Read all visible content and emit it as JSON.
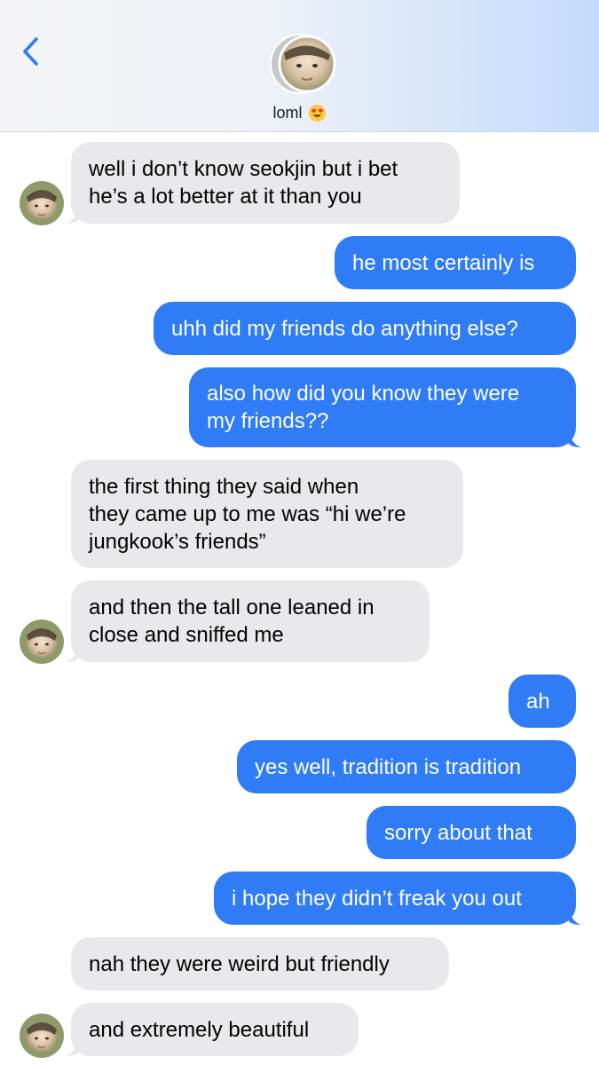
{
  "header": {
    "contact_name": "loml",
    "contact_emoji": "heart-eyes-emoji",
    "back_icon": "chevron-left-icon",
    "accent_color": "#2f7cf6"
  },
  "messages": [
    {
      "from": "them",
      "lines": [
        "well i don’t know seokjin but i bet",
        "he’s a lot better at it than you"
      ]
    },
    {
      "from": "me",
      "lines": [
        "he most certainly is"
      ]
    },
    {
      "from": "me",
      "lines": [
        "uhh did my friends do anything else?"
      ]
    },
    {
      "from": "me",
      "lines": [
        "also how did you know they were",
        "my friends??"
      ]
    },
    {
      "from": "them",
      "lines": [
        "the first thing they said when",
        "they came up to me was “hi we’re",
        "jungkook’s friends”"
      ]
    },
    {
      "from": "them",
      "lines": [
        "and then the tall one leaned in",
        "close and sniffed me"
      ]
    },
    {
      "from": "me",
      "lines": [
        "ah"
      ]
    },
    {
      "from": "me",
      "lines": [
        "yes well, tradition is tradition"
      ]
    },
    {
      "from": "me",
      "lines": [
        "sorry about that"
      ]
    },
    {
      "from": "me",
      "lines": [
        "i hope they didn’t freak you out"
      ]
    },
    {
      "from": "them",
      "lines": [
        "nah they were weird but friendly"
      ]
    },
    {
      "from": "them",
      "lines": [
        "and extremely beautiful"
      ]
    }
  ]
}
